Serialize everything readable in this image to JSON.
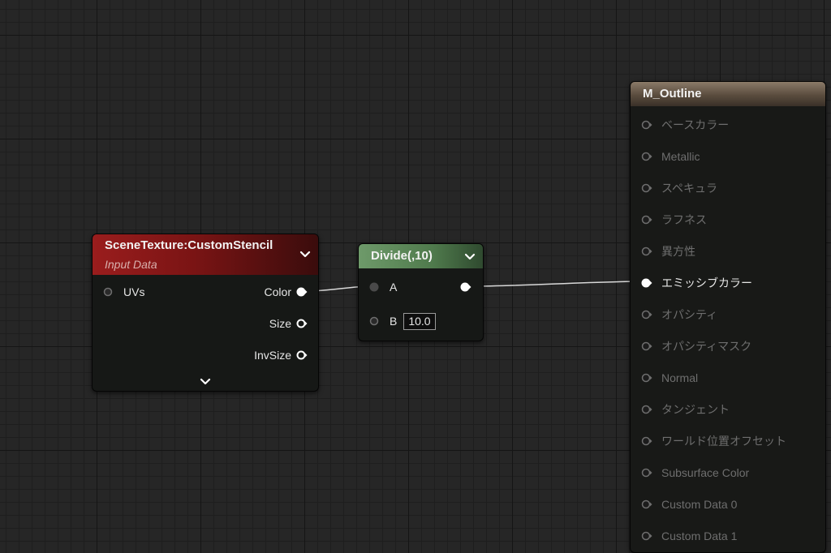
{
  "nodes": {
    "scene_texture": {
      "title": "SceneTexture:CustomStencil",
      "subtitle": "Input Data",
      "inputs": [
        "UVs"
      ],
      "outputs": [
        "Color",
        "Size",
        "InvSize"
      ]
    },
    "divide": {
      "title": "Divide(,10)",
      "inputs": [
        "A",
        "B"
      ],
      "b_value": "10.0"
    },
    "material": {
      "title": "M_Outline",
      "inputs": [
        {
          "label": "ベースカラー",
          "active": false
        },
        {
          "label": "Metallic",
          "active": false
        },
        {
          "label": "スペキュラ",
          "active": false
        },
        {
          "label": "ラフネス",
          "active": false
        },
        {
          "label": "異方性",
          "active": false
        },
        {
          "label": "エミッシブカラー",
          "active": true
        },
        {
          "label": "オパシティ",
          "active": false
        },
        {
          "label": "オパシティマスク",
          "active": false
        },
        {
          "label": "Normal",
          "active": false
        },
        {
          "label": "タンジェント",
          "active": false
        },
        {
          "label": "ワールド位置オフセット",
          "active": false
        },
        {
          "label": "Subsurface Color",
          "active": false
        },
        {
          "label": "Custom Data 0",
          "active": false
        },
        {
          "label": "Custom Data 1",
          "active": false
        }
      ]
    }
  },
  "colors": {
    "scene_header": "#9a1d1d",
    "divide_header": "#6e9a6a",
    "material_header": "#8a7a68",
    "wire": "#d8d8d8",
    "pin_connected": "#ffffff",
    "pin_inactive": "#6e6e6e"
  }
}
